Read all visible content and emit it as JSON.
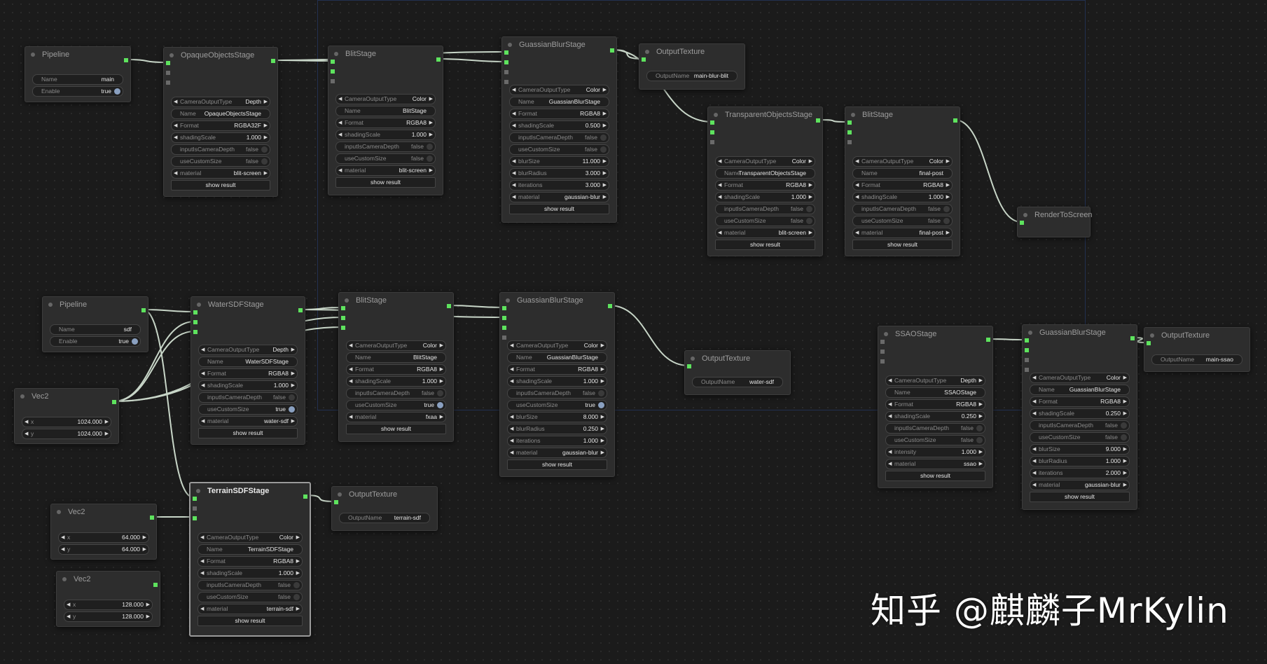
{
  "graph": {
    "nodes": [
      {
        "title": "Pipeline",
        "widgets": [
          {
            "kind": "text",
            "label": "Name",
            "value": "main"
          },
          {
            "kind": "toggle",
            "label": "Enable",
            "value": "true",
            "on": true
          }
        ]
      },
      {
        "title": "OpaqueObjectsStage",
        "widgets": [
          {
            "kind": "combo",
            "label": "CameraOutputType",
            "value": "Depth"
          },
          {
            "kind": "text",
            "label": "Name",
            "value": "OpaqueObjectsStage"
          },
          {
            "kind": "combo",
            "label": "Format",
            "value": "RGBA32F"
          },
          {
            "kind": "number",
            "label": "shadingScale",
            "value": "1.000"
          },
          {
            "kind": "toggle",
            "label": "inputIsCameraDepth",
            "value": "false",
            "on": false
          },
          {
            "kind": "toggle",
            "label": "useCustomSize",
            "value": "false",
            "on": false
          },
          {
            "kind": "combo",
            "label": "material",
            "value": "blit-screen"
          },
          {
            "kind": "button",
            "label": "show result"
          }
        ]
      },
      {
        "title": "BlitStage",
        "widgets": [
          {
            "kind": "combo",
            "label": "CameraOutputType",
            "value": "Color"
          },
          {
            "kind": "text",
            "label": "Name",
            "value": "BlitStage"
          },
          {
            "kind": "combo",
            "label": "Format",
            "value": "RGBA8"
          },
          {
            "kind": "number",
            "label": "shadingScale",
            "value": "1.000"
          },
          {
            "kind": "toggle",
            "label": "inputIsCameraDepth",
            "value": "false",
            "on": false
          },
          {
            "kind": "toggle",
            "label": "useCustomSize",
            "value": "false",
            "on": false
          },
          {
            "kind": "combo",
            "label": "material",
            "value": "blit-screen"
          },
          {
            "kind": "button",
            "label": "show result"
          }
        ]
      },
      {
        "title": "GuassianBlurStage",
        "widgets": [
          {
            "kind": "combo",
            "label": "CameraOutputType",
            "value": "Color"
          },
          {
            "kind": "text",
            "label": "Name",
            "value": "GuassianBlurStage"
          },
          {
            "kind": "combo",
            "label": "Format",
            "value": "RGBA8"
          },
          {
            "kind": "number",
            "label": "shadingScale",
            "value": "0.500"
          },
          {
            "kind": "toggle",
            "label": "inputIsCameraDepth",
            "value": "false",
            "on": false
          },
          {
            "kind": "toggle",
            "label": "useCustomSize",
            "value": "false",
            "on": false
          },
          {
            "kind": "number",
            "label": "blurSize",
            "value": "11.000"
          },
          {
            "kind": "number",
            "label": "blurRadius",
            "value": "3.000"
          },
          {
            "kind": "number",
            "label": "iterations",
            "value": "3.000"
          },
          {
            "kind": "combo",
            "label": "material",
            "value": "gaussian-blur"
          },
          {
            "kind": "button",
            "label": "show result"
          }
        ]
      },
      {
        "title": "OutputTexture",
        "widgets": [
          {
            "kind": "text",
            "label": "OutputName",
            "value": "main-blur-blit"
          }
        ]
      },
      {
        "title": "TransparentObjectsStage",
        "widgets": [
          {
            "kind": "combo",
            "label": "CameraOutputType",
            "value": "Color"
          },
          {
            "kind": "text",
            "label": "Name",
            "value": "TransparentObjectsStage"
          },
          {
            "kind": "combo",
            "label": "Format",
            "value": "RGBA8"
          },
          {
            "kind": "number",
            "label": "shadingScale",
            "value": "1.000"
          },
          {
            "kind": "toggle",
            "label": "inputIsCameraDepth",
            "value": "false",
            "on": false
          },
          {
            "kind": "toggle",
            "label": "useCustomSize",
            "value": "false",
            "on": false
          },
          {
            "kind": "combo",
            "label": "material",
            "value": "blit-screen"
          },
          {
            "kind": "button",
            "label": "show result"
          }
        ]
      },
      {
        "title": "BlitStage",
        "widgets": [
          {
            "kind": "combo",
            "label": "CameraOutputType",
            "value": "Color"
          },
          {
            "kind": "text",
            "label": "Name",
            "value": "final-post"
          },
          {
            "kind": "combo",
            "label": "Format",
            "value": "RGBA8"
          },
          {
            "kind": "number",
            "label": "shadingScale",
            "value": "1.000"
          },
          {
            "kind": "toggle",
            "label": "inputIsCameraDepth",
            "value": "false",
            "on": false
          },
          {
            "kind": "toggle",
            "label": "useCustomSize",
            "value": "false",
            "on": false
          },
          {
            "kind": "combo",
            "label": "material",
            "value": "final-post"
          },
          {
            "kind": "button",
            "label": "show result"
          }
        ]
      },
      {
        "title": "RenderToScreen",
        "widgets": []
      },
      {
        "title": "Pipeline",
        "widgets": [
          {
            "kind": "text",
            "label": "Name",
            "value": "sdf"
          },
          {
            "kind": "toggle",
            "label": "Enable",
            "value": "true",
            "on": true
          }
        ]
      },
      {
        "title": "WaterSDFStage",
        "widgets": [
          {
            "kind": "combo",
            "label": "CameraOutputType",
            "value": "Depth"
          },
          {
            "kind": "text",
            "label": "Name",
            "value": "WaterSDFStage"
          },
          {
            "kind": "combo",
            "label": "Format",
            "value": "RGBA8"
          },
          {
            "kind": "number",
            "label": "shadingScale",
            "value": "1.000"
          },
          {
            "kind": "toggle",
            "label": "inputIsCameraDepth",
            "value": "false",
            "on": false
          },
          {
            "kind": "toggle",
            "label": "useCustomSize",
            "value": "true",
            "on": true
          },
          {
            "kind": "combo",
            "label": "material",
            "value": "water-sdf"
          },
          {
            "kind": "button",
            "label": "show result"
          }
        ]
      },
      {
        "title": "BlitStage",
        "widgets": [
          {
            "kind": "combo",
            "label": "CameraOutputType",
            "value": "Color"
          },
          {
            "kind": "text",
            "label": "Name",
            "value": "BlitStage"
          },
          {
            "kind": "combo",
            "label": "Format",
            "value": "RGBA8"
          },
          {
            "kind": "number",
            "label": "shadingScale",
            "value": "1.000"
          },
          {
            "kind": "toggle",
            "label": "inputIsCameraDepth",
            "value": "false",
            "on": false
          },
          {
            "kind": "toggle",
            "label": "useCustomSize",
            "value": "true",
            "on": true
          },
          {
            "kind": "combo",
            "label": "material",
            "value": "fxaa"
          },
          {
            "kind": "button",
            "label": "show result"
          }
        ]
      },
      {
        "title": "GuassianBlurStage",
        "widgets": [
          {
            "kind": "combo",
            "label": "CameraOutputType",
            "value": "Color"
          },
          {
            "kind": "text",
            "label": "Name",
            "value": "GuassianBlurStage"
          },
          {
            "kind": "combo",
            "label": "Format",
            "value": "RGBA8"
          },
          {
            "kind": "number",
            "label": "shadingScale",
            "value": "1.000"
          },
          {
            "kind": "toggle",
            "label": "inputIsCameraDepth",
            "value": "false",
            "on": false
          },
          {
            "kind": "toggle",
            "label": "useCustomSize",
            "value": "true",
            "on": true
          },
          {
            "kind": "number",
            "label": "blurSize",
            "value": "8.000"
          },
          {
            "kind": "number",
            "label": "blurRadius",
            "value": "0.250"
          },
          {
            "kind": "number",
            "label": "iterations",
            "value": "1.000"
          },
          {
            "kind": "combo",
            "label": "material",
            "value": "gaussian-blur"
          },
          {
            "kind": "button",
            "label": "show result"
          }
        ]
      },
      {
        "title": "OutputTexture",
        "widgets": [
          {
            "kind": "text",
            "label": "OutputName",
            "value": "water-sdf"
          }
        ]
      },
      {
        "title": "Vec2",
        "widgets": [
          {
            "kind": "number",
            "label": "x",
            "value": "1024.000"
          },
          {
            "kind": "number",
            "label": "y",
            "value": "1024.000"
          }
        ]
      },
      {
        "title": "TerrainSDFStage",
        "widgets": [
          {
            "kind": "combo",
            "label": "CameraOutputType",
            "value": "Color"
          },
          {
            "kind": "text",
            "label": "Name",
            "value": "TerrainSDFStage"
          },
          {
            "kind": "combo",
            "label": "Format",
            "value": "RGBA8"
          },
          {
            "kind": "number",
            "label": "shadingScale",
            "value": "1.000"
          },
          {
            "kind": "toggle",
            "label": "inputIsCameraDepth",
            "value": "false",
            "on": false
          },
          {
            "kind": "toggle",
            "label": "useCustomSize",
            "value": "false",
            "on": false
          },
          {
            "kind": "combo",
            "label": "material",
            "value": "terrain-sdf"
          },
          {
            "kind": "button",
            "label": "show result"
          }
        ]
      },
      {
        "title": "OutputTexture",
        "widgets": [
          {
            "kind": "text",
            "label": "OutputName",
            "value": "terrain-sdf"
          }
        ]
      },
      {
        "title": "Vec2",
        "widgets": [
          {
            "kind": "number",
            "label": "x",
            "value": "64.000"
          },
          {
            "kind": "number",
            "label": "y",
            "value": "64.000"
          }
        ]
      },
      {
        "title": "Vec2",
        "widgets": [
          {
            "kind": "number",
            "label": "x",
            "value": "128.000"
          },
          {
            "kind": "number",
            "label": "y",
            "value": "128.000"
          }
        ]
      },
      {
        "title": "SSAOStage",
        "widgets": [
          {
            "kind": "combo",
            "label": "CameraOutputType",
            "value": "Depth"
          },
          {
            "kind": "text",
            "label": "Name",
            "value": "SSAOStage"
          },
          {
            "kind": "combo",
            "label": "Format",
            "value": "RGBA8"
          },
          {
            "kind": "number",
            "label": "shadingScale",
            "value": "0.250"
          },
          {
            "kind": "toggle",
            "label": "inputIsCameraDepth",
            "value": "false",
            "on": false
          },
          {
            "kind": "toggle",
            "label": "useCustomSize",
            "value": "false",
            "on": false
          },
          {
            "kind": "number",
            "label": "intensity",
            "value": "1.000"
          },
          {
            "kind": "combo",
            "label": "material",
            "value": "ssao"
          },
          {
            "kind": "button",
            "label": "show result"
          }
        ]
      },
      {
        "title": "GuassianBlurStage",
        "widgets": [
          {
            "kind": "combo",
            "label": "CameraOutputType",
            "value": "Color"
          },
          {
            "kind": "text",
            "label": "Name",
            "value": "GuassianBlurStage"
          },
          {
            "kind": "combo",
            "label": "Format",
            "value": "RGBA8"
          },
          {
            "kind": "number",
            "label": "shadingScale",
            "value": "0.250"
          },
          {
            "kind": "toggle",
            "label": "inputIsCameraDepth",
            "value": "false",
            "on": false
          },
          {
            "kind": "toggle",
            "label": "useCustomSize",
            "value": "false",
            "on": false
          },
          {
            "kind": "number",
            "label": "blurSize",
            "value": "9.000"
          },
          {
            "kind": "number",
            "label": "blurRadius",
            "value": "1.000"
          },
          {
            "kind": "number",
            "label": "iterations",
            "value": "2.000"
          },
          {
            "kind": "combo",
            "label": "material",
            "value": "gaussian-blur"
          },
          {
            "kind": "button",
            "label": "show result"
          }
        ]
      },
      {
        "title": "OutputTexture",
        "widgets": [
          {
            "kind": "text",
            "label": "OutputName",
            "value": "main-ssao"
          }
        ]
      }
    ]
  },
  "colors": {
    "background": "#1b1b1b",
    "node": "#2d2d2d",
    "link": "#c8d6c8",
    "slot_connected": "#5ee35e"
  },
  "watermark": "知乎 @麒麟子MrKylin"
}
